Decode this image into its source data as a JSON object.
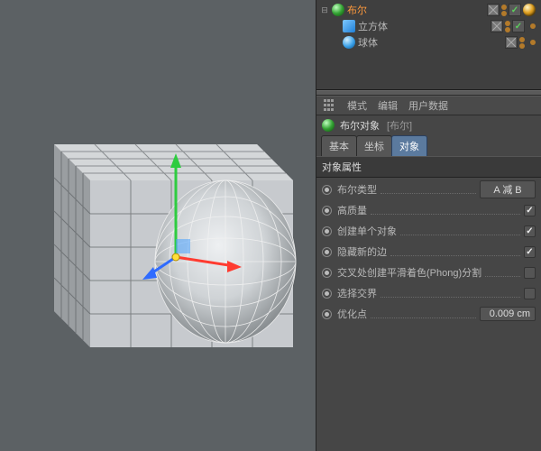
{
  "objects": {
    "root": {
      "label": "布尔",
      "icon": "boole"
    },
    "children": [
      {
        "label": "立方体",
        "icon": "cube"
      },
      {
        "label": "球体",
        "icon": "sphere"
      }
    ]
  },
  "attr_menu": {
    "mode": "模式",
    "edit": "编辑",
    "userdata": "用户数据"
  },
  "attr_title": {
    "name": "布尔对象",
    "suffix": "[布尔]"
  },
  "tabs": {
    "basic": "基本",
    "coord": "坐标",
    "object": "对象"
  },
  "section": "对象属性",
  "props": {
    "boole_type": {
      "label": "布尔类型",
      "value": "A 减 B"
    },
    "high_quality": {
      "label": "高质量",
      "checked": true
    },
    "single_obj": {
      "label": "创建单个对象",
      "checked": true
    },
    "hide_new": {
      "label": "隐藏新的边",
      "checked": true
    },
    "phong_break": {
      "label": "交叉处创建平滑着色(Phong)分割",
      "checked": false
    },
    "sel_bound": {
      "label": "选择交界",
      "checked": false
    },
    "optimize": {
      "label": "优化点",
      "value": "0.009 cm"
    }
  }
}
